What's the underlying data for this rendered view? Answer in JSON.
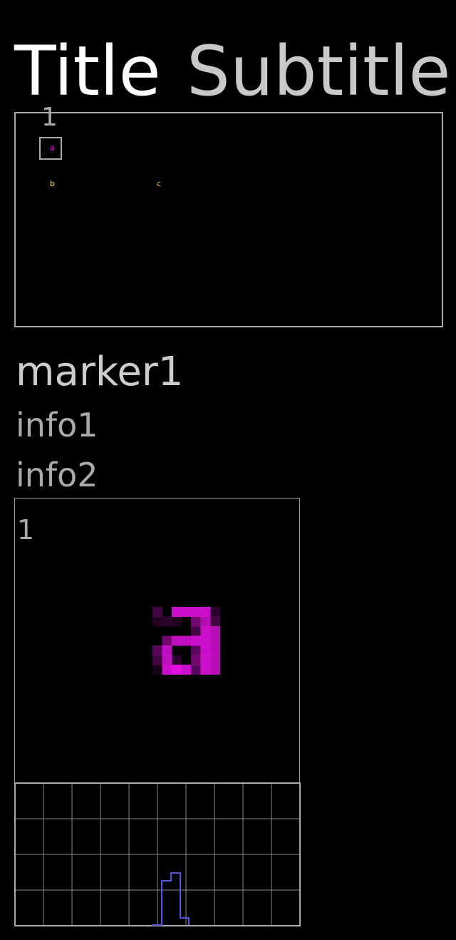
{
  "header": {
    "title": "Title",
    "subtitle": "Subtitle"
  },
  "overview": {
    "marker_label": "1",
    "points": [
      {
        "label": "a",
        "color": "#ff00ff"
      },
      {
        "label": "b",
        "color": "#ffee33"
      },
      {
        "label": "c",
        "color": "#ffbb33"
      }
    ]
  },
  "marker": {
    "name": "marker1",
    "info1": "info1",
    "info2": "info2"
  },
  "zoom": {
    "label": "1",
    "glyph": "a",
    "glyph_color": "#e010e0"
  },
  "histogram": {
    "line_color": "#5555dd",
    "grid_color": "#888888"
  }
}
